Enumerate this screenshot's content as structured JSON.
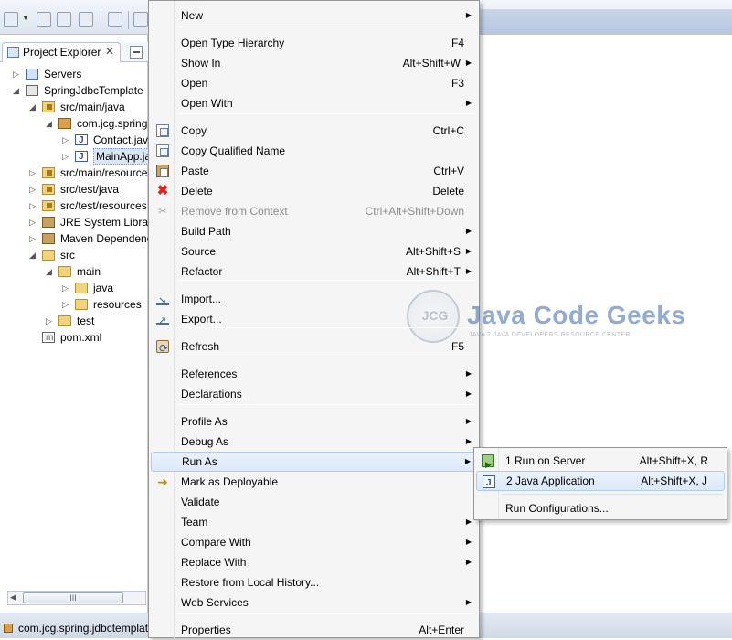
{
  "explorer": {
    "tab_label": "Project Explorer",
    "tab_close": "✕",
    "tree": [
      {
        "label": "Servers",
        "icon": "server-folder-icon",
        "twist": "▷"
      },
      {
        "label": "SpringJdbcTemplate",
        "icon": "project-icon",
        "twist": "◢"
      },
      {
        "label": "src/main/java",
        "icon": "source-folder-icon",
        "twist": "◢"
      },
      {
        "label": "com.jcg.spring",
        "icon": "package-icon",
        "twist": "◢"
      },
      {
        "label": "Contact.java",
        "icon": "java-file-icon",
        "twist": "▷"
      },
      {
        "label": "MainApp.java",
        "icon": "java-file-icon",
        "twist": "▷"
      },
      {
        "label": "src/main/resources",
        "icon": "source-folder-icon",
        "twist": "▷"
      },
      {
        "label": "src/test/java",
        "icon": "source-folder-icon",
        "twist": "▷"
      },
      {
        "label": "src/test/resources",
        "icon": "source-folder-icon",
        "twist": "▷"
      },
      {
        "label": "JRE System Library",
        "icon": "library-icon",
        "twist": "▷"
      },
      {
        "label": "Maven Dependencies",
        "icon": "library-icon",
        "twist": "▷"
      },
      {
        "label": "src",
        "icon": "folder-icon",
        "twist": "◢"
      },
      {
        "label": "main",
        "icon": "folder-icon",
        "twist": "◢"
      },
      {
        "label": "java",
        "icon": "folder-icon",
        "twist": "▷"
      },
      {
        "label": "resources",
        "icon": "folder-icon",
        "twist": "▷"
      },
      {
        "label": "test",
        "icon": "folder-icon",
        "twist": "▷"
      },
      {
        "label": "pom.xml",
        "icon": "xml-file-icon",
        "twist": ""
      }
    ],
    "scroll_thumb": "III"
  },
  "status": {
    "text": "com.jcg.spring.jdbctemplate"
  },
  "context_menu": {
    "items": [
      {
        "label": "New",
        "accel": "",
        "submenu": true
      },
      {
        "label": "Open Type Hierarchy",
        "accel": "F4",
        "submenu": false
      },
      {
        "label": "Show In",
        "accel": "Alt+Shift+W",
        "submenu": true
      },
      {
        "label": "Open",
        "accel": "F3",
        "submenu": false
      },
      {
        "label": "Open With",
        "accel": "",
        "submenu": true
      },
      {
        "label": "Copy",
        "accel": "Ctrl+C",
        "submenu": false
      },
      {
        "label": "Copy Qualified Name",
        "accel": "",
        "submenu": false
      },
      {
        "label": "Paste",
        "accel": "Ctrl+V",
        "submenu": false
      },
      {
        "label": "Delete",
        "accel": "Delete",
        "submenu": false
      },
      {
        "label": "Remove from Context",
        "accel": "Ctrl+Alt+Shift+Down",
        "submenu": false
      },
      {
        "label": "Build Path",
        "accel": "",
        "submenu": true
      },
      {
        "label": "Source",
        "accel": "Alt+Shift+S",
        "submenu": true
      },
      {
        "label": "Refactor",
        "accel": "Alt+Shift+T",
        "submenu": true
      },
      {
        "label": "Import...",
        "accel": "",
        "submenu": false
      },
      {
        "label": "Export...",
        "accel": "",
        "submenu": false
      },
      {
        "label": "Refresh",
        "accel": "F5",
        "submenu": false
      },
      {
        "label": "References",
        "accel": "",
        "submenu": true
      },
      {
        "label": "Declarations",
        "accel": "",
        "submenu": true
      },
      {
        "label": "Profile As",
        "accel": "",
        "submenu": true
      },
      {
        "label": "Debug As",
        "accel": "",
        "submenu": true
      },
      {
        "label": "Run As",
        "accel": "",
        "submenu": true
      },
      {
        "label": "Mark as Deployable",
        "accel": "",
        "submenu": false
      },
      {
        "label": "Validate",
        "accel": "",
        "submenu": false
      },
      {
        "label": "Team",
        "accel": "",
        "submenu": true
      },
      {
        "label": "Compare With",
        "accel": "",
        "submenu": true
      },
      {
        "label": "Replace With",
        "accel": "",
        "submenu": true
      },
      {
        "label": "Restore from Local History...",
        "accel": "",
        "submenu": false
      },
      {
        "label": "Web Services",
        "accel": "",
        "submenu": true
      },
      {
        "label": "Properties",
        "accel": "Alt+Enter",
        "submenu": false
      }
    ],
    "submenu_arrow": "▶"
  },
  "run_as_menu": {
    "items": [
      {
        "label": "1 Run on Server",
        "accel": "Alt+Shift+X, R"
      },
      {
        "label": "2 Java Application",
        "accel": "Alt+Shift+X, J"
      },
      {
        "label": "Run Configurations...",
        "accel": ""
      }
    ]
  },
  "watermark": {
    "circle_text": "JCG",
    "name": "Java Code Geeks",
    "tagline": "JAVA 2 JAVA DEVELOPERS RESOURCE CENTER"
  }
}
